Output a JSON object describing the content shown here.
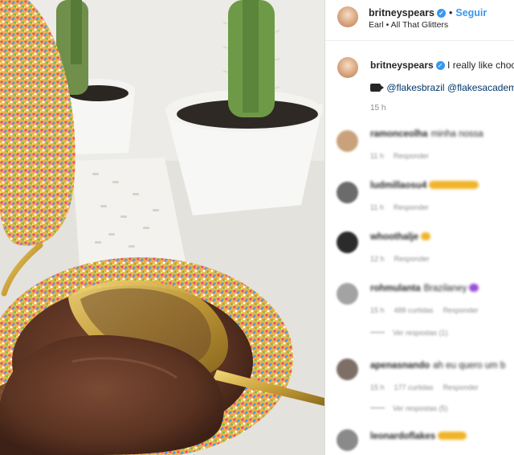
{
  "post_header": {
    "username": "britneyspears",
    "verified_icon": "verified-badge-icon",
    "separator": "•",
    "follow_label": "Seguir",
    "subtitle": "Earl • All That Glitters"
  },
  "caption": {
    "username": "britneyspears",
    "text": "I really like choc",
    "video_icon": "camera-icon",
    "mentions": [
      "@flakesbrazil",
      "@flakesacadem"
    ],
    "time": "15 h"
  },
  "comments": [
    {
      "username": "ramonceolha",
      "text": "minha nossa",
      "time": "11 h",
      "reply_label": "Responder",
      "emoji": "",
      "avatar_color": "#c9a27c"
    },
    {
      "username": "ludmillaosu4",
      "text": "",
      "time": "11 h",
      "reply_label": "Responder",
      "emoji": "#f0b429",
      "avatar_color": "#6b6b6b"
    },
    {
      "username": "whoothalje",
      "text": "",
      "time": "12 h",
      "reply_label": "Responder",
      "emoji": "#f0b429",
      "avatar_color": "#2b2b2b"
    },
    {
      "username": "rohmulanta",
      "text": "Brazilaney",
      "time": "15 h",
      "likes": "488 curtidas",
      "reply_label": "Responder",
      "emoji": "#9b4dd6",
      "view_replies": "Ver respostas (1)",
      "avatar_color": "#a3a3a3"
    },
    {
      "username": "apenasnando",
      "text": "ah eu quero um b",
      "time": "15 h",
      "likes": "177 curtidas",
      "reply_label": "Responder",
      "emoji": "",
      "view_replies": "Ver respostas (5)",
      "avatar_color": "#7d6f66"
    },
    {
      "username": "leonardoflakes",
      "text": "",
      "time": "",
      "reply_label": "",
      "emoji": "#f0b429",
      "avatar_color": "#8a8a8a"
    }
  ],
  "colors": {
    "accent": "#3897f0",
    "muted": "#8e8e8e",
    "text": "#262626"
  }
}
